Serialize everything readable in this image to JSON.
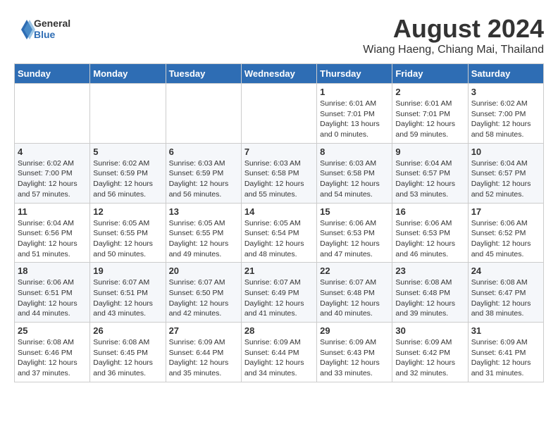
{
  "header": {
    "logo_line1": "General",
    "logo_line2": "Blue",
    "month_year": "August 2024",
    "location": "Wiang Haeng, Chiang Mai, Thailand"
  },
  "weekdays": [
    "Sunday",
    "Monday",
    "Tuesday",
    "Wednesday",
    "Thursday",
    "Friday",
    "Saturday"
  ],
  "weeks": [
    [
      {
        "day": "",
        "sunrise": "",
        "sunset": "",
        "daylight": ""
      },
      {
        "day": "",
        "sunrise": "",
        "sunset": "",
        "daylight": ""
      },
      {
        "day": "",
        "sunrise": "",
        "sunset": "",
        "daylight": ""
      },
      {
        "day": "",
        "sunrise": "",
        "sunset": "",
        "daylight": ""
      },
      {
        "day": "1",
        "sunrise": "Sunrise: 6:01 AM",
        "sunset": "Sunset: 7:01 PM",
        "daylight": "Daylight: 13 hours and 0 minutes."
      },
      {
        "day": "2",
        "sunrise": "Sunrise: 6:01 AM",
        "sunset": "Sunset: 7:01 PM",
        "daylight": "Daylight: 12 hours and 59 minutes."
      },
      {
        "day": "3",
        "sunrise": "Sunrise: 6:02 AM",
        "sunset": "Sunset: 7:00 PM",
        "daylight": "Daylight: 12 hours and 58 minutes."
      }
    ],
    [
      {
        "day": "4",
        "sunrise": "Sunrise: 6:02 AM",
        "sunset": "Sunset: 7:00 PM",
        "daylight": "Daylight: 12 hours and 57 minutes."
      },
      {
        "day": "5",
        "sunrise": "Sunrise: 6:02 AM",
        "sunset": "Sunset: 6:59 PM",
        "daylight": "Daylight: 12 hours and 56 minutes."
      },
      {
        "day": "6",
        "sunrise": "Sunrise: 6:03 AM",
        "sunset": "Sunset: 6:59 PM",
        "daylight": "Daylight: 12 hours and 56 minutes."
      },
      {
        "day": "7",
        "sunrise": "Sunrise: 6:03 AM",
        "sunset": "Sunset: 6:58 PM",
        "daylight": "Daylight: 12 hours and 55 minutes."
      },
      {
        "day": "8",
        "sunrise": "Sunrise: 6:03 AM",
        "sunset": "Sunset: 6:58 PM",
        "daylight": "Daylight: 12 hours and 54 minutes."
      },
      {
        "day": "9",
        "sunrise": "Sunrise: 6:04 AM",
        "sunset": "Sunset: 6:57 PM",
        "daylight": "Daylight: 12 hours and 53 minutes."
      },
      {
        "day": "10",
        "sunrise": "Sunrise: 6:04 AM",
        "sunset": "Sunset: 6:57 PM",
        "daylight": "Daylight: 12 hours and 52 minutes."
      }
    ],
    [
      {
        "day": "11",
        "sunrise": "Sunrise: 6:04 AM",
        "sunset": "Sunset: 6:56 PM",
        "daylight": "Daylight: 12 hours and 51 minutes."
      },
      {
        "day": "12",
        "sunrise": "Sunrise: 6:05 AM",
        "sunset": "Sunset: 6:55 PM",
        "daylight": "Daylight: 12 hours and 50 minutes."
      },
      {
        "day": "13",
        "sunrise": "Sunrise: 6:05 AM",
        "sunset": "Sunset: 6:55 PM",
        "daylight": "Daylight: 12 hours and 49 minutes."
      },
      {
        "day": "14",
        "sunrise": "Sunrise: 6:05 AM",
        "sunset": "Sunset: 6:54 PM",
        "daylight": "Daylight: 12 hours and 48 minutes."
      },
      {
        "day": "15",
        "sunrise": "Sunrise: 6:06 AM",
        "sunset": "Sunset: 6:53 PM",
        "daylight": "Daylight: 12 hours and 47 minutes."
      },
      {
        "day": "16",
        "sunrise": "Sunrise: 6:06 AM",
        "sunset": "Sunset: 6:53 PM",
        "daylight": "Daylight: 12 hours and 46 minutes."
      },
      {
        "day": "17",
        "sunrise": "Sunrise: 6:06 AM",
        "sunset": "Sunset: 6:52 PM",
        "daylight": "Daylight: 12 hours and 45 minutes."
      }
    ],
    [
      {
        "day": "18",
        "sunrise": "Sunrise: 6:06 AM",
        "sunset": "Sunset: 6:51 PM",
        "daylight": "Daylight: 12 hours and 44 minutes."
      },
      {
        "day": "19",
        "sunrise": "Sunrise: 6:07 AM",
        "sunset": "Sunset: 6:51 PM",
        "daylight": "Daylight: 12 hours and 43 minutes."
      },
      {
        "day": "20",
        "sunrise": "Sunrise: 6:07 AM",
        "sunset": "Sunset: 6:50 PM",
        "daylight": "Daylight: 12 hours and 42 minutes."
      },
      {
        "day": "21",
        "sunrise": "Sunrise: 6:07 AM",
        "sunset": "Sunset: 6:49 PM",
        "daylight": "Daylight: 12 hours and 41 minutes."
      },
      {
        "day": "22",
        "sunrise": "Sunrise: 6:07 AM",
        "sunset": "Sunset: 6:48 PM",
        "daylight": "Daylight: 12 hours and 40 minutes."
      },
      {
        "day": "23",
        "sunrise": "Sunrise: 6:08 AM",
        "sunset": "Sunset: 6:48 PM",
        "daylight": "Daylight: 12 hours and 39 minutes."
      },
      {
        "day": "24",
        "sunrise": "Sunrise: 6:08 AM",
        "sunset": "Sunset: 6:47 PM",
        "daylight": "Daylight: 12 hours and 38 minutes."
      }
    ],
    [
      {
        "day": "25",
        "sunrise": "Sunrise: 6:08 AM",
        "sunset": "Sunset: 6:46 PM",
        "daylight": "Daylight: 12 hours and 37 minutes."
      },
      {
        "day": "26",
        "sunrise": "Sunrise: 6:08 AM",
        "sunset": "Sunset: 6:45 PM",
        "daylight": "Daylight: 12 hours and 36 minutes."
      },
      {
        "day": "27",
        "sunrise": "Sunrise: 6:09 AM",
        "sunset": "Sunset: 6:44 PM",
        "daylight": "Daylight: 12 hours and 35 minutes."
      },
      {
        "day": "28",
        "sunrise": "Sunrise: 6:09 AM",
        "sunset": "Sunset: 6:44 PM",
        "daylight": "Daylight: 12 hours and 34 minutes."
      },
      {
        "day": "29",
        "sunrise": "Sunrise: 6:09 AM",
        "sunset": "Sunset: 6:43 PM",
        "daylight": "Daylight: 12 hours and 33 minutes."
      },
      {
        "day": "30",
        "sunrise": "Sunrise: 6:09 AM",
        "sunset": "Sunset: 6:42 PM",
        "daylight": "Daylight: 12 hours and 32 minutes."
      },
      {
        "day": "31",
        "sunrise": "Sunrise: 6:09 AM",
        "sunset": "Sunset: 6:41 PM",
        "daylight": "Daylight: 12 hours and 31 minutes."
      }
    ]
  ]
}
